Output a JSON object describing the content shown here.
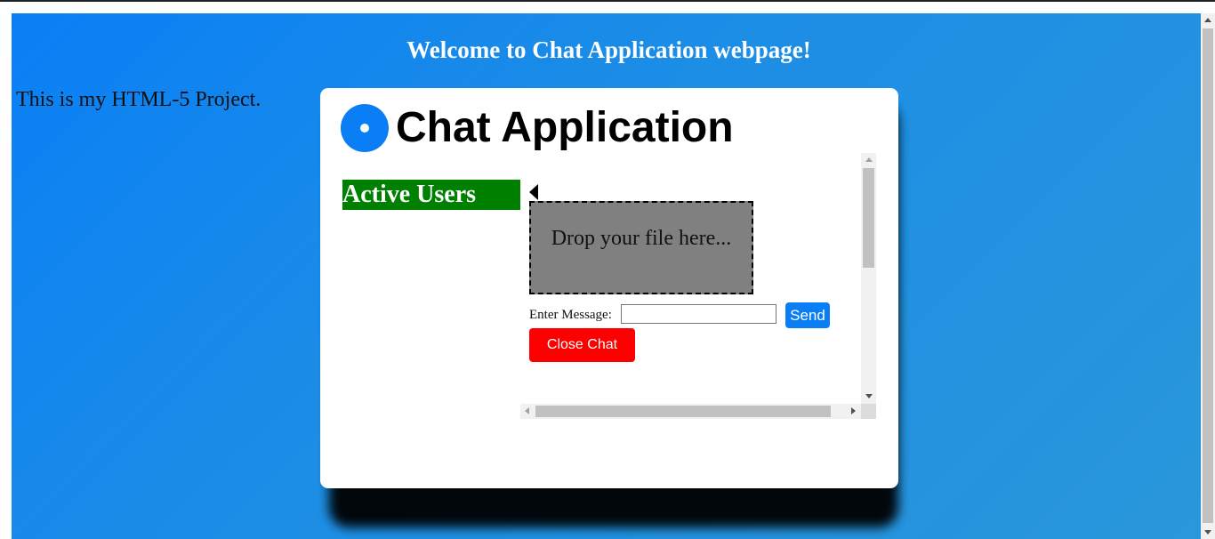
{
  "page": {
    "heading": "Welcome to Chat Application webpage!",
    "intro": "This is my HTML-5 Project."
  },
  "modal": {
    "title": "Chat Application",
    "logo_icon": "circle-dot-icon",
    "active_users_heading": "Active Users",
    "dropzone_text": "Drop your file here...",
    "message_label": "Enter Message:",
    "message_value": "",
    "message_placeholder": "",
    "send_label": "Send",
    "close_label": "Close Chat"
  },
  "colors": {
    "background_gradient": [
      "#0a7ff5",
      "#2a97da"
    ],
    "accent": "#0a7ff5",
    "active_users_bg": "#008000",
    "dropzone_bg": "#808080",
    "close_button": "#ff0000"
  }
}
